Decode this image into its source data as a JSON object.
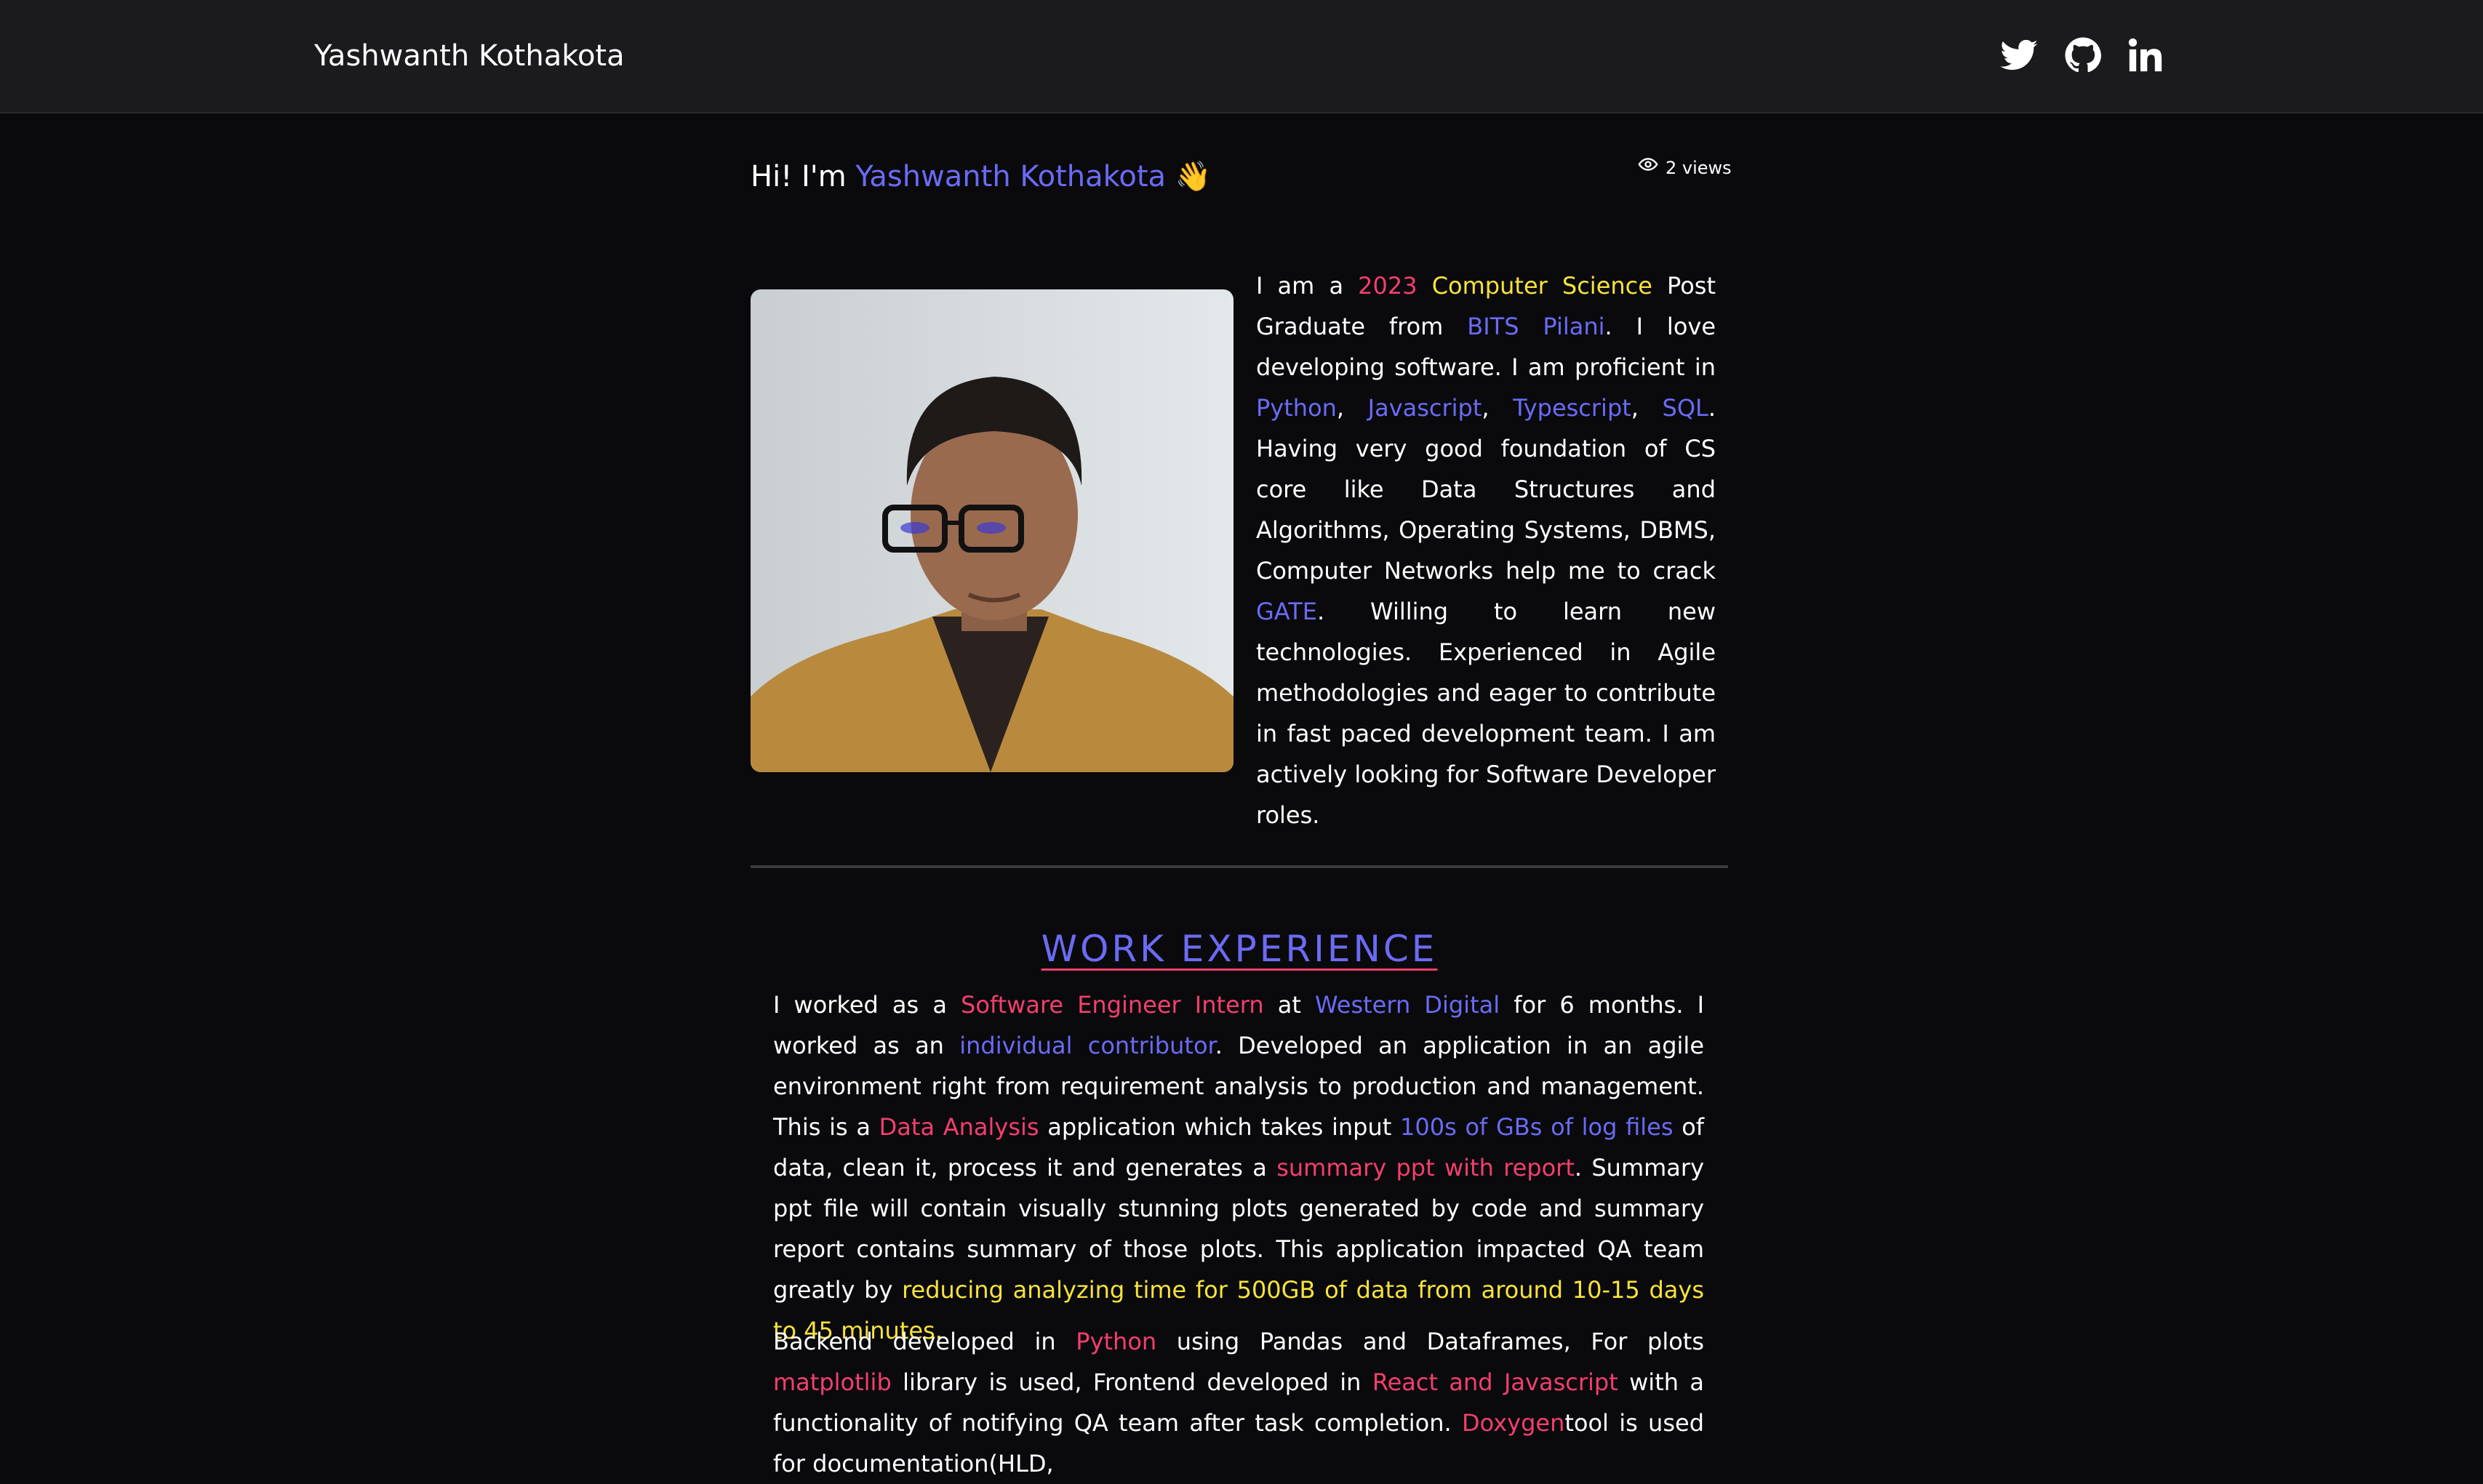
{
  "nav": {
    "brand": "Yashwanth Kothakota",
    "social_icons": [
      "twitter-icon",
      "github-icon",
      "linkedin-icon"
    ]
  },
  "hero": {
    "greeting_prefix": "Hi! I'm ",
    "name": "Yashwanth Kothakota",
    "wave": "👋",
    "views_count": "2 views"
  },
  "bio": {
    "t1": "I am a ",
    "year": "2023",
    "t2": " ",
    "field": "Computer Science",
    "t3": " Post Graduate from ",
    "college": "BITS Pilani",
    "t4": ". I love developing software. I am proficient in ",
    "lang1": "Python",
    "t5": ", ",
    "lang2": "Javascript",
    "t6": ", ",
    "lang3": "Typescript",
    "t7": ", ",
    "lang4": "SQL",
    "t8": ". Having very good foundation of CS core like Data Structures and Algorithms, Operating Systems, DBMS, Computer Networks help me to crack ",
    "exam": "GATE",
    "t9": ". Willing to learn new technologies. Experienced in Agile methodologies and eager to contribute in fast paced development team. I am actively looking for Software Developer roles."
  },
  "work": {
    "title": "WORK EXPERIENCE",
    "p1": {
      "a": "I worked as a ",
      "role": "Software Engineer Intern",
      "b": " at ",
      "company": "Western Digital",
      "c": " for 6 months. I worked as an ",
      "contributor": "individual contributor",
      "d": ". Developed an application in an agile environment right from requirement analysis to production and management. This is a ",
      "domain": "Data Analysis",
      "e": " application which takes input ",
      "input": "100s of GBs of log files",
      "f": " of data, clean it, process it and generates a ",
      "output": "summary ppt with report",
      "g": ". Summary ppt file will contain visually stunning plots generated by code and summary report contains summary of those plots. This application impacted QA team greatly by ",
      "impact": "reducing analyzing time for 500GB of data from around 10-15 days to 45 minutes."
    },
    "p2": {
      "a": "Backend developed in ",
      "lang": "Python",
      "b": " using Pandas and Dataframes, For plots ",
      "lib": "matplotlib",
      "c": " library is used, Frontend developed in ",
      "frontend": "React and Javascript",
      "d": " with a functionality of notifying QA team after task completion. ",
      "doc": "Doxygen",
      "e": "tool is used for documentation(HLD,"
    }
  },
  "colors": {
    "accent_blue": "#6b6bf5",
    "accent_red": "#f43f6e",
    "accent_yellow": "#f8e33a",
    "background": "#0a0a0d",
    "header": "#1b1b1e"
  }
}
